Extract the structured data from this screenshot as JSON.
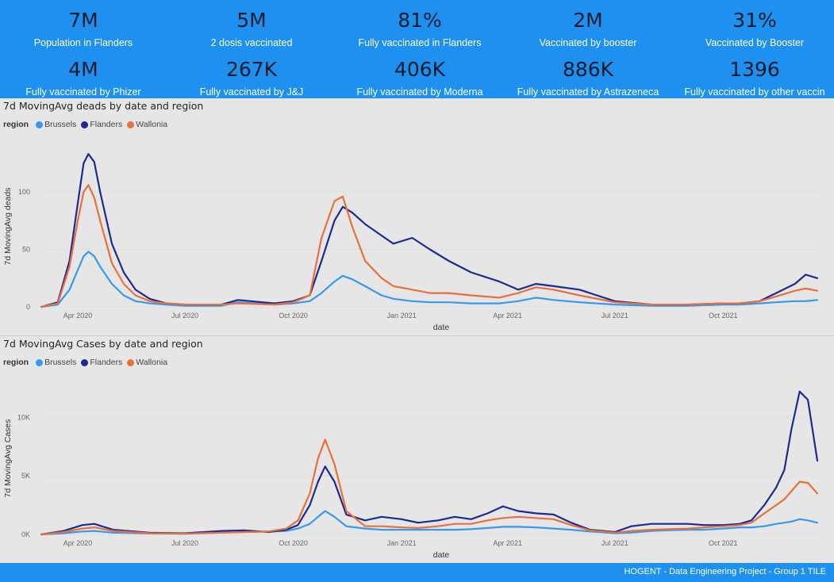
{
  "kpis_row1": [
    {
      "value": "7M",
      "label": "Population in Flanders"
    },
    {
      "value": "5M",
      "label": "2 dosis vaccinated"
    },
    {
      "value": "81%",
      "label": "Fully vaccinated in Flanders"
    },
    {
      "value": "2M",
      "label": "Vaccinated by booster"
    },
    {
      "value": "31%",
      "label": "Vaccinated by Booster"
    }
  ],
  "kpis_row2": [
    {
      "value": "4M",
      "label": "Fully vaccinated by Phizer"
    },
    {
      "value": "267K",
      "label": "Fully vaccinated by J&J"
    },
    {
      "value": "406K",
      "label": "Fully vaccinated by Moderna"
    },
    {
      "value": "886K",
      "label": "Fully vaccinated by Astrazeneca"
    },
    {
      "value": "1396",
      "label": "Fully vaccinated by other vaccin"
    }
  ],
  "colors": {
    "brussels": "#3599f0",
    "flanders": "#1b2a94",
    "wallonia": "#e8703a",
    "band": "#1e90f0"
  },
  "footer": "HOGENT - Data Engineering Project - Group 1 TILE",
  "chart_data": [
    {
      "type": "line",
      "title": "7d MovingAvg deads by date and region",
      "legend_title": "region",
      "legend_placement": "top-left",
      "xlabel": "date",
      "ylabel": "7d MovingAvg deads",
      "x_ticks": [
        "Apr 2020",
        "Jul 2020",
        "Oct 2020",
        "Jan 2021",
        "Apr 2021",
        "Jul 2021",
        "Oct 2021"
      ],
      "y_ticks": [
        "0",
        "50",
        "100"
      ],
      "y_tick_values": [
        0,
        50,
        100
      ],
      "ylim": [
        0,
        140
      ],
      "grid": "horizontal dotted",
      "x": [
        "2020-03-01",
        "2020-03-15",
        "2020-03-25",
        "2020-04-01",
        "2020-04-06",
        "2020-04-10",
        "2020-04-15",
        "2020-04-20",
        "2020-04-30",
        "2020-05-10",
        "2020-05-20",
        "2020-06-01",
        "2020-06-15",
        "2020-07-01",
        "2020-08-01",
        "2020-08-15",
        "2020-09-15",
        "2020-10-01",
        "2020-10-15",
        "2020-10-25",
        "2020-11-05",
        "2020-11-12",
        "2020-11-20",
        "2020-12-01",
        "2020-12-15",
        "2020-12-25",
        "2021-01-10",
        "2021-01-25",
        "2021-02-10",
        "2021-03-01",
        "2021-03-25",
        "2021-04-10",
        "2021-04-25",
        "2021-05-10",
        "2021-06-01",
        "2021-07-01",
        "2021-08-01",
        "2021-09-01",
        "2021-10-01",
        "2021-10-15",
        "2021-11-01",
        "2021-11-15",
        "2021-12-01",
        "2021-12-10",
        "2021-12-20"
      ],
      "series": [
        {
          "name": "Brussels",
          "values": [
            0,
            2,
            15,
            32,
            44,
            48,
            44,
            35,
            20,
            10,
            5,
            3,
            2,
            1,
            1,
            4,
            2,
            3,
            5,
            12,
            22,
            27,
            24,
            18,
            10,
            7,
            5,
            4,
            4,
            3,
            3,
            5,
            8,
            6,
            4,
            2,
            1,
            1,
            2,
            2,
            3,
            4,
            5,
            5,
            6
          ]
        },
        {
          "name": "Flanders",
          "values": [
            0,
            4,
            40,
            90,
            125,
            133,
            126,
            100,
            55,
            30,
            15,
            7,
            3,
            2,
            2,
            6,
            3,
            5,
            10,
            40,
            75,
            87,
            82,
            72,
            62,
            55,
            60,
            50,
            40,
            30,
            22,
            15,
            20,
            18,
            15,
            5,
            2,
            2,
            3,
            3,
            5,
            12,
            20,
            28,
            25
          ]
        },
        {
          "name": "Wallonia",
          "values": [
            0,
            3,
            35,
            75,
            100,
            106,
            95,
            75,
            38,
            20,
            10,
            5,
            3,
            2,
            2,
            3,
            2,
            4,
            10,
            60,
            92,
            96,
            70,
            40,
            25,
            18,
            15,
            12,
            12,
            10,
            8,
            12,
            17,
            15,
            10,
            4,
            2,
            2,
            3,
            3,
            5,
            9,
            14,
            16,
            14
          ]
        }
      ]
    },
    {
      "type": "line",
      "title": "7d MovingAvg Cases by date and region",
      "legend_title": "region",
      "legend_placement": "top-left",
      "xlabel": "date",
      "ylabel": "7d MovingAvg Cases",
      "x_ticks": [
        "Apr 2020",
        "Jul 2020",
        "Oct 2020",
        "Jan 2021",
        "Apr 2021",
        "Jul 2021",
        "Oct 2021"
      ],
      "y_ticks": [
        "0K",
        "5K",
        "10K"
      ],
      "y_tick_values": [
        0,
        5000,
        10000
      ],
      "ylim": [
        0,
        13000
      ],
      "grid": "horizontal dotted",
      "x": [
        "2020-03-01",
        "2020-03-20",
        "2020-04-05",
        "2020-04-15",
        "2020-05-01",
        "2020-06-01",
        "2020-07-01",
        "2020-08-01",
        "2020-08-20",
        "2020-09-10",
        "2020-09-25",
        "2020-10-05",
        "2020-10-15",
        "2020-10-22",
        "2020-10-28",
        "2020-11-05",
        "2020-11-15",
        "2020-12-01",
        "2020-12-15",
        "2021-01-01",
        "2021-01-15",
        "2021-02-01",
        "2021-02-15",
        "2021-03-01",
        "2021-03-15",
        "2021-03-28",
        "2021-04-10",
        "2021-04-25",
        "2021-05-10",
        "2021-05-25",
        "2021-06-10",
        "2021-07-01",
        "2021-07-15",
        "2021-08-01",
        "2021-08-15",
        "2021-09-01",
        "2021-09-15",
        "2021-10-01",
        "2021-10-15",
        "2021-10-25",
        "2021-11-05",
        "2021-11-15",
        "2021-11-22",
        "2021-11-28",
        "2021-12-05",
        "2021-12-12",
        "2021-12-20"
      ],
      "series": [
        {
          "name": "Brussels",
          "values": [
            0,
            100,
            250,
            300,
            150,
            80,
            60,
            150,
            200,
            250,
            300,
            500,
            900,
            1500,
            2000,
            1500,
            700,
            500,
            400,
            400,
            400,
            400,
            400,
            450,
            550,
            650,
            650,
            600,
            500,
            400,
            250,
            100,
            150,
            300,
            350,
            400,
            400,
            500,
            600,
            600,
            700,
            900,
            1000,
            1100,
            1300,
            1200,
            1000
          ]
        },
        {
          "name": "Flanders",
          "values": [
            0,
            300,
            800,
            900,
            400,
            150,
            100,
            300,
            350,
            200,
            400,
            800,
            2500,
            4500,
            5800,
            4500,
            1700,
            1200,
            1500,
            1300,
            1000,
            1200,
            1500,
            1300,
            1800,
            2400,
            2000,
            1800,
            1700,
            1000,
            400,
            200,
            700,
            900,
            900,
            900,
            800,
            800,
            900,
            1200,
            2500,
            4000,
            5500,
            9000,
            12200,
            11500,
            6300
          ]
        },
        {
          "name": "Wallonia",
          "values": [
            0,
            200,
            500,
            600,
            300,
            100,
            80,
            150,
            200,
            250,
            500,
            1200,
            3500,
            6500,
            8100,
            6000,
            2000,
            700,
            700,
            600,
            550,
            700,
            900,
            900,
            1200,
            1400,
            1500,
            1400,
            1300,
            800,
            350,
            150,
            300,
            400,
            450,
            500,
            600,
            700,
            800,
            1000,
            1800,
            2500,
            3000,
            3700,
            4500,
            4400,
            3500
          ]
        }
      ]
    }
  ]
}
